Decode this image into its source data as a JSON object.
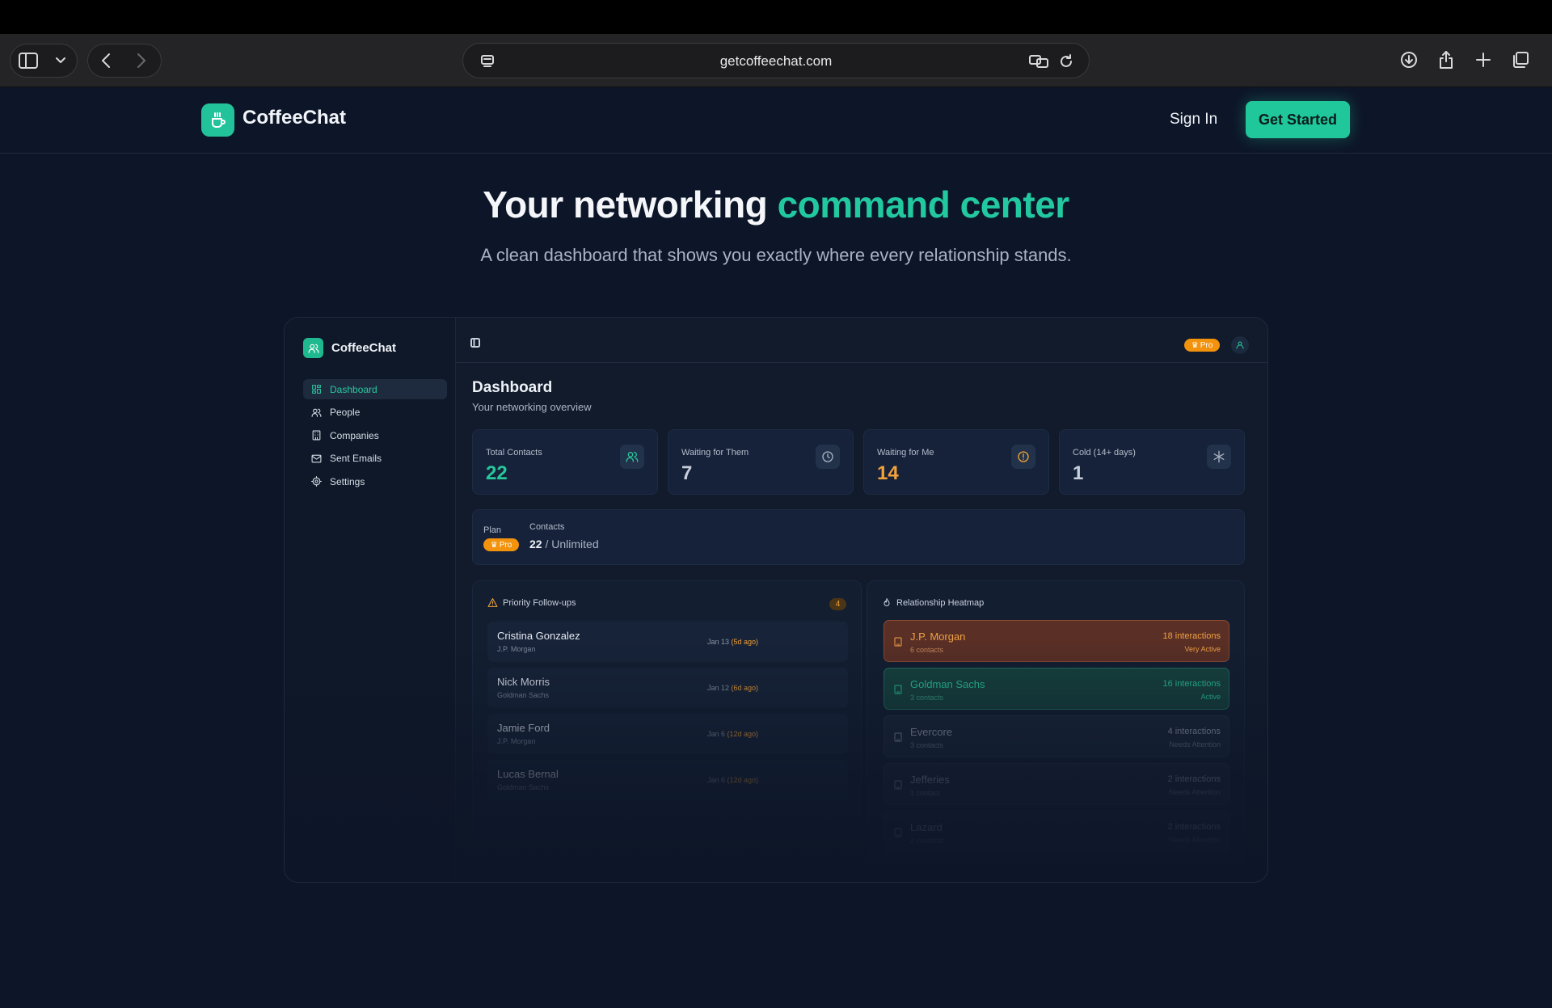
{
  "browser": {
    "url": "getcoffeechat.com"
  },
  "site": {
    "brand": "CoffeeChat",
    "sign_in": "Sign In",
    "get_started": "Get Started"
  },
  "hero": {
    "title_main": "Your networking ",
    "title_accent": "command center",
    "subtitle": "A clean dashboard that shows you exactly where every relationship stands."
  },
  "app": {
    "brand": "CoffeeChat",
    "nav": [
      {
        "label": "Dashboard",
        "icon": "grid-icon"
      },
      {
        "label": "People",
        "icon": "users-icon"
      },
      {
        "label": "Companies",
        "icon": "building-icon"
      },
      {
        "label": "Sent Emails",
        "icon": "mail-icon"
      },
      {
        "label": "Settings",
        "icon": "gear-icon"
      }
    ],
    "pro_badge": "Pro",
    "title": "Dashboard",
    "subtitle": "Your networking overview",
    "stats": [
      {
        "label": "Total Contacts",
        "value": "22",
        "color": "#27c79c",
        "icon": "users-icon"
      },
      {
        "label": "Waiting for Them",
        "value": "7",
        "color": "#c7cfdb",
        "icon": "clock-icon"
      },
      {
        "label": "Waiting for Me",
        "value": "14",
        "color": "#f2a23a",
        "icon": "alert-icon"
      },
      {
        "label": "Cold (14+ days)",
        "value": "1",
        "color": "#c7cfdb",
        "icon": "snowflake-icon"
      }
    ],
    "plan": {
      "plan_label": "Plan",
      "plan_badge": "Pro",
      "contacts_label": "Contacts",
      "contacts_count": "22",
      "contacts_limit": " / Unlimited"
    },
    "followups": {
      "title": "Priority Follow-ups",
      "count": "4",
      "items": [
        {
          "name": "Cristina Gonzalez",
          "company": "J.P. Morgan",
          "date": "Jan 13 ",
          "ago": "(5d ago)"
        },
        {
          "name": "Nick Morris",
          "company": "Goldman Sachs",
          "date": "Jan 12 ",
          "ago": "(6d ago)"
        },
        {
          "name": "Jamie Ford",
          "company": "J.P. Morgan",
          "date": "Jan 6 ",
          "ago": "(12d ago)"
        },
        {
          "name": "Lucas Bernal",
          "company": "Goldman Sachs",
          "date": "Jan 6 ",
          "ago": "(12d ago)"
        }
      ]
    },
    "heatmap": {
      "title": "Relationship Heatmap",
      "items": [
        {
          "name": "J.P. Morgan",
          "contacts": "6 contacts",
          "interactions": "18 interactions",
          "status": "Very Active"
        },
        {
          "name": "Goldman Sachs",
          "contacts": "3 contacts",
          "interactions": "16 interactions",
          "status": "Active"
        },
        {
          "name": "Evercore",
          "contacts": "3 contacts",
          "interactions": "4 interactions",
          "status": "Needs Attention"
        },
        {
          "name": "Jefferies",
          "contacts": "1 contact",
          "interactions": "2 interactions",
          "status": "Needs Attention"
        },
        {
          "name": "Lazard",
          "contacts": "2 contacts",
          "interactions": "2 interactions",
          "status": "Needs Attention"
        }
      ]
    }
  }
}
